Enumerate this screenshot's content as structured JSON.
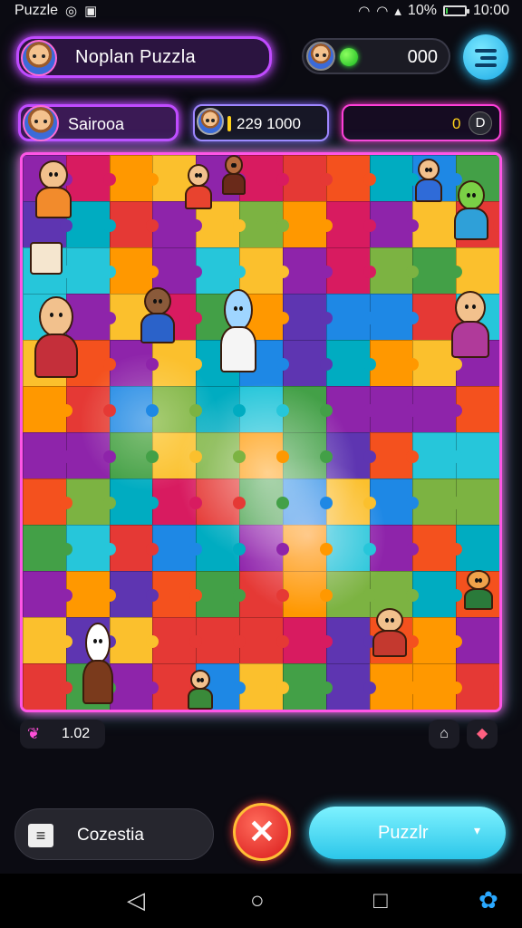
{
  "status_bar": {
    "app_name": "Puzzle",
    "battery_text": "10%",
    "time": "10:00",
    "battery_level": 0.1,
    "icons": [
      "gamepad-icon",
      "image-icon",
      "wifi-icon",
      "wifi-icon",
      "signal-icon",
      "battery-icon"
    ]
  },
  "header": {
    "title": "Noplan Puzzla",
    "coins": "000",
    "menu_icon": "hamburger-icon"
  },
  "player_bar": {
    "player_name": "Sairooa",
    "score_text": "229 1000",
    "right_value": "0",
    "right_icon_glyph": "D"
  },
  "board": {
    "columns": 11,
    "rows": 12,
    "palette": [
      "#e53935",
      "#ff9800",
      "#fbc02d",
      "#43a047",
      "#1e88e5",
      "#8e24aa",
      "#d81b60",
      "#00acc1",
      "#7cb342",
      "#5e35b1",
      "#f4511e",
      "#26c6da"
    ]
  },
  "footer": {
    "counter_icon": "bow-icon",
    "counter_value": "1.02",
    "btn_a": "⌂",
    "btn_b": "◆",
    "collection_label": "Cozestia",
    "close_glyph": "✕",
    "puzzle_label": "Puzzlr",
    "puzzle_caret": "▾"
  },
  "nav": {
    "back": "◁",
    "home": "○",
    "recents": "□",
    "settings": "✿"
  }
}
